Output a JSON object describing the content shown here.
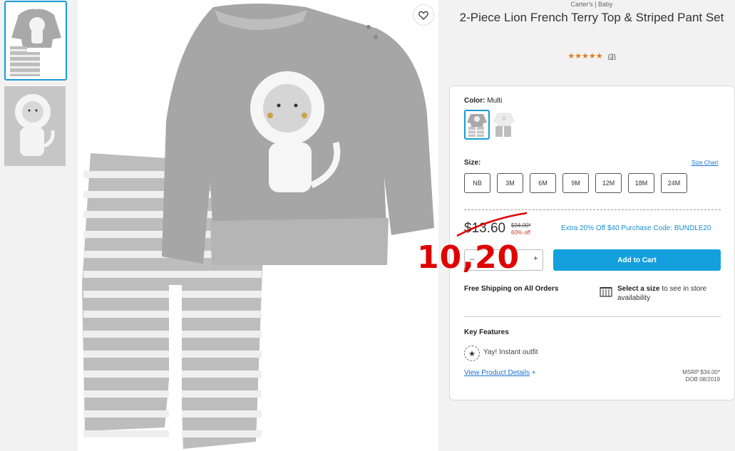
{
  "product": {
    "brand": "Carter's | Baby",
    "title": "2-Piece Lion French Terry Top & Striped Pant Set",
    "stars": "★★★★★",
    "review_count": "(3)"
  },
  "color": {
    "label": "Color:",
    "value": "Multi"
  },
  "size": {
    "label": "Size:",
    "chart_link": "Size Chart",
    "options": [
      "NB",
      "3M",
      "6M",
      "9M",
      "12M",
      "18M",
      "24M"
    ]
  },
  "pricing": {
    "price": "$13.60",
    "original": "$34.00*",
    "discount": "60% off",
    "promo": "Extra 20% Off $40 Purchase Code: BUNDLE20",
    "handwritten_note": "10,20"
  },
  "quantity": {
    "minus": "−",
    "value": "1",
    "plus": "+"
  },
  "add_to_cart": "Add to Cart",
  "shipping": "Free Shipping on All Orders",
  "store": {
    "bold": "Select a size",
    "rest": " to see in store availability"
  },
  "key_features": {
    "heading": "Key Features",
    "items": [
      "Yay! Instant outfit"
    ]
  },
  "details": {
    "link": "View Product Details",
    "plus": "+"
  },
  "msrp": {
    "line1": "MSRP $34.00*",
    "line2": "DOB 08/2019"
  },
  "colors": {
    "accent": "#1a9ad6",
    "cart_button": "#14a0dc",
    "star": "#e07a1c",
    "sale_red": "#d0352b",
    "note_red": "#e00000"
  }
}
